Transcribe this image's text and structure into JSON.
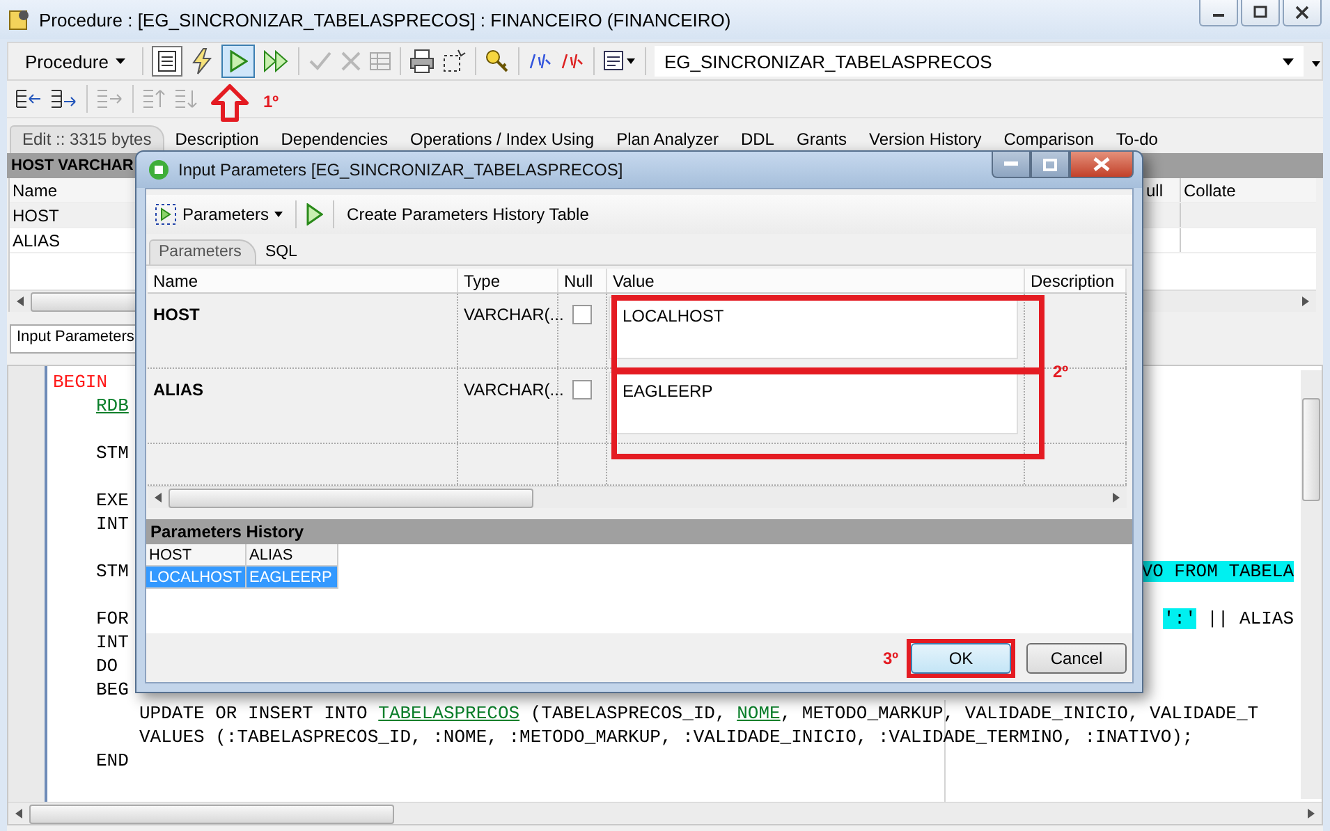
{
  "window": {
    "title": "Procedure : [EG_SINCRONIZAR_TABELASPRECOS] : FINANCEIRO (FINANCEIRO)"
  },
  "toolbar": {
    "object_type": "Procedure",
    "run_pressed": true,
    "object_name": "EG_SINCRONIZAR_TABELASPRECOS",
    "annotation": "1º"
  },
  "tabs": [
    {
      "label": "Edit :: 3315 bytes",
      "selected": true
    },
    {
      "label": "Description",
      "selected": false
    },
    {
      "label": "Dependencies",
      "selected": false
    },
    {
      "label": "Operations / Index Using",
      "selected": false
    },
    {
      "label": "Plan Analyzer",
      "selected": false
    },
    {
      "label": "DDL",
      "selected": false
    },
    {
      "label": "Grants",
      "selected": false
    },
    {
      "label": "Version History",
      "selected": false
    },
    {
      "label": "Comparison",
      "selected": false
    },
    {
      "label": "To-do",
      "selected": false
    }
  ],
  "params_table": {
    "header": "HOST VARCHAR",
    "columns": [
      "Name",
      "ull",
      "Collate"
    ],
    "rows": [
      {
        "name": "HOST"
      },
      {
        "name": "ALIAS"
      }
    ]
  },
  "bottom_tab": "Input Parameters",
  "editor": {
    "lines": [
      {
        "kind": "top",
        "segments": [
          {
            "kind": "keyword",
            "text": "BEGIN"
          }
        ]
      },
      {
        "kind": "block",
        "segments": [
          {
            "kind": "link",
            "text": "RDB"
          }
        ]
      },
      {
        "kind": "blank"
      },
      {
        "kind": "block",
        "segments": [
          {
            "kind": "plain",
            "text": "STM"
          }
        ]
      },
      {
        "kind": "blank"
      },
      {
        "kind": "block",
        "segments": [
          {
            "kind": "plain",
            "text": "EXE"
          }
        ]
      },
      {
        "kind": "block",
        "segments": [
          {
            "kind": "plain",
            "text": "INT"
          }
        ]
      },
      {
        "kind": "blank"
      },
      {
        "kind": "block",
        "segments": [
          {
            "kind": "plain",
            "text": "STM"
          }
        ],
        "tail": [
          {
            "kind": "highlight",
            "text": "VO FROM TABELA"
          }
        ]
      },
      {
        "kind": "blank"
      },
      {
        "kind": "block",
        "segments": [
          {
            "kind": "plain",
            "text": "FOR"
          }
        ],
        "tail": [
          {
            "kind": "highlight",
            "text": "':'"
          },
          {
            "kind": "plain",
            "text": " || ALIAS"
          }
        ]
      },
      {
        "kind": "block",
        "segments": [
          {
            "kind": "plain",
            "text": "INT"
          }
        ]
      },
      {
        "kind": "block",
        "segments": [
          {
            "kind": "plain",
            "text": "DO"
          }
        ]
      },
      {
        "kind": "block",
        "segments": [
          {
            "kind": "plain",
            "text": "BEG"
          }
        ]
      },
      {
        "kind": "inner",
        "segments": [
          {
            "kind": "plain",
            "text": "UPDATE OR INSERT INTO "
          },
          {
            "kind": "link",
            "text": "TABELASPRECOS"
          },
          {
            "kind": "plain",
            "text": " (TABELASPRECOS_ID, "
          },
          {
            "kind": "link",
            "text": "NOME"
          },
          {
            "kind": "plain",
            "text": ", METODO_MARKUP, VALIDADE_INICIO, VALIDADE_T"
          }
        ]
      },
      {
        "kind": "inner",
        "segments": [
          {
            "kind": "plain",
            "text": "VALUES (:TABELASPRECOS_ID, :NOME, :METODO_MARKUP, :VALIDADE_INICIO, :VALIDADE_TERMINO, :INATIVO);"
          }
        ]
      },
      {
        "kind": "block",
        "segments": [
          {
            "kind": "plain",
            "text": "END"
          }
        ]
      }
    ]
  },
  "dialog": {
    "title": "Input Parameters [EG_SINCRONIZAR_TABELASPRECOS]",
    "toolbar": {
      "menu": "Parameters",
      "action": "Create Parameters History Table"
    },
    "tabs": [
      {
        "label": "Parameters",
        "selected": true
      },
      {
        "label": "SQL",
        "selected": false
      }
    ],
    "columns": [
      "Name",
      "Type",
      "Null",
      "Value",
      "Description"
    ],
    "rows": [
      {
        "name": "HOST",
        "type": "VARCHAR(...",
        "null": false,
        "value": "LOCALHOST"
      },
      {
        "name": "ALIAS",
        "type": "VARCHAR(...",
        "null": false,
        "value": "EAGLEERP"
      }
    ],
    "grid_annotation": "2º",
    "history": {
      "title": "Parameters History",
      "columns": [
        "HOST",
        "ALIAS"
      ],
      "rows": [
        {
          "cells": [
            "LOCALHOST",
            "EAGLEERP"
          ],
          "selected": true
        }
      ]
    },
    "footer_annotation": "3º",
    "buttons": [
      "OK",
      "Cancel"
    ]
  }
}
